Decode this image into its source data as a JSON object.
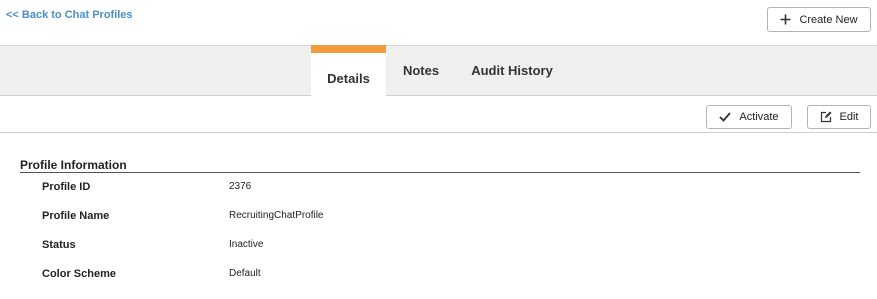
{
  "nav": {
    "back_label": "<< Back to Chat Profiles"
  },
  "toolbar": {
    "create_label": "Create New",
    "activate_label": "Activate",
    "edit_label": "Edit"
  },
  "tabs": [
    {
      "label": "Details",
      "active": true
    },
    {
      "label": "Notes",
      "active": false
    },
    {
      "label": "Audit History",
      "active": false
    }
  ],
  "section": {
    "title": "Profile Information",
    "fields": [
      {
        "label": "Profile ID",
        "value": "2376"
      },
      {
        "label": "Profile Name",
        "value": "RecruitingChatProfile"
      },
      {
        "label": "Status",
        "value": "Inactive"
      },
      {
        "label": "Color Scheme",
        "value": "Default"
      }
    ]
  },
  "icons": {
    "create": "plus-icon",
    "activate": "checkmark-icon",
    "edit": "edit-icon"
  },
  "colors": {
    "link": "#4a90c8",
    "active_tab_accent": "#f29a3c",
    "tab_bar_bg": "#efefef"
  }
}
